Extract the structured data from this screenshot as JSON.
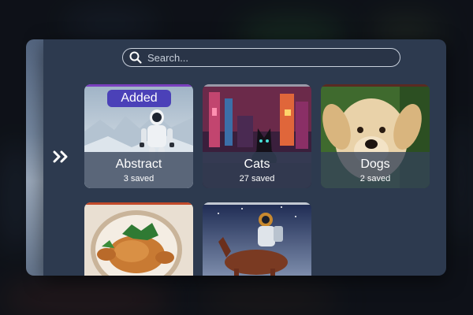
{
  "search": {
    "placeholder": "Search..."
  },
  "expand": {
    "icon": "double-chevron-right-icon"
  },
  "collections": [
    {
      "name": "Abstract",
      "count": "3 saved",
      "badge": "Added",
      "image": "astronaut in snowy landscape"
    },
    {
      "name": "Cats",
      "count": "27 saved",
      "image": "cyberpunk cat in neon city"
    },
    {
      "name": "Dogs",
      "count": "2 saved",
      "image": "golden puppy"
    },
    {
      "name": "",
      "count": "",
      "image": "roast chicken on plate"
    },
    {
      "name": "",
      "count": "",
      "image": "astronaut riding horse"
    }
  ],
  "colors": {
    "panel": "#2d3a4f",
    "badge": "#4b41b8",
    "overlay": "#344258",
    "search_border": "#c8d0dc"
  }
}
